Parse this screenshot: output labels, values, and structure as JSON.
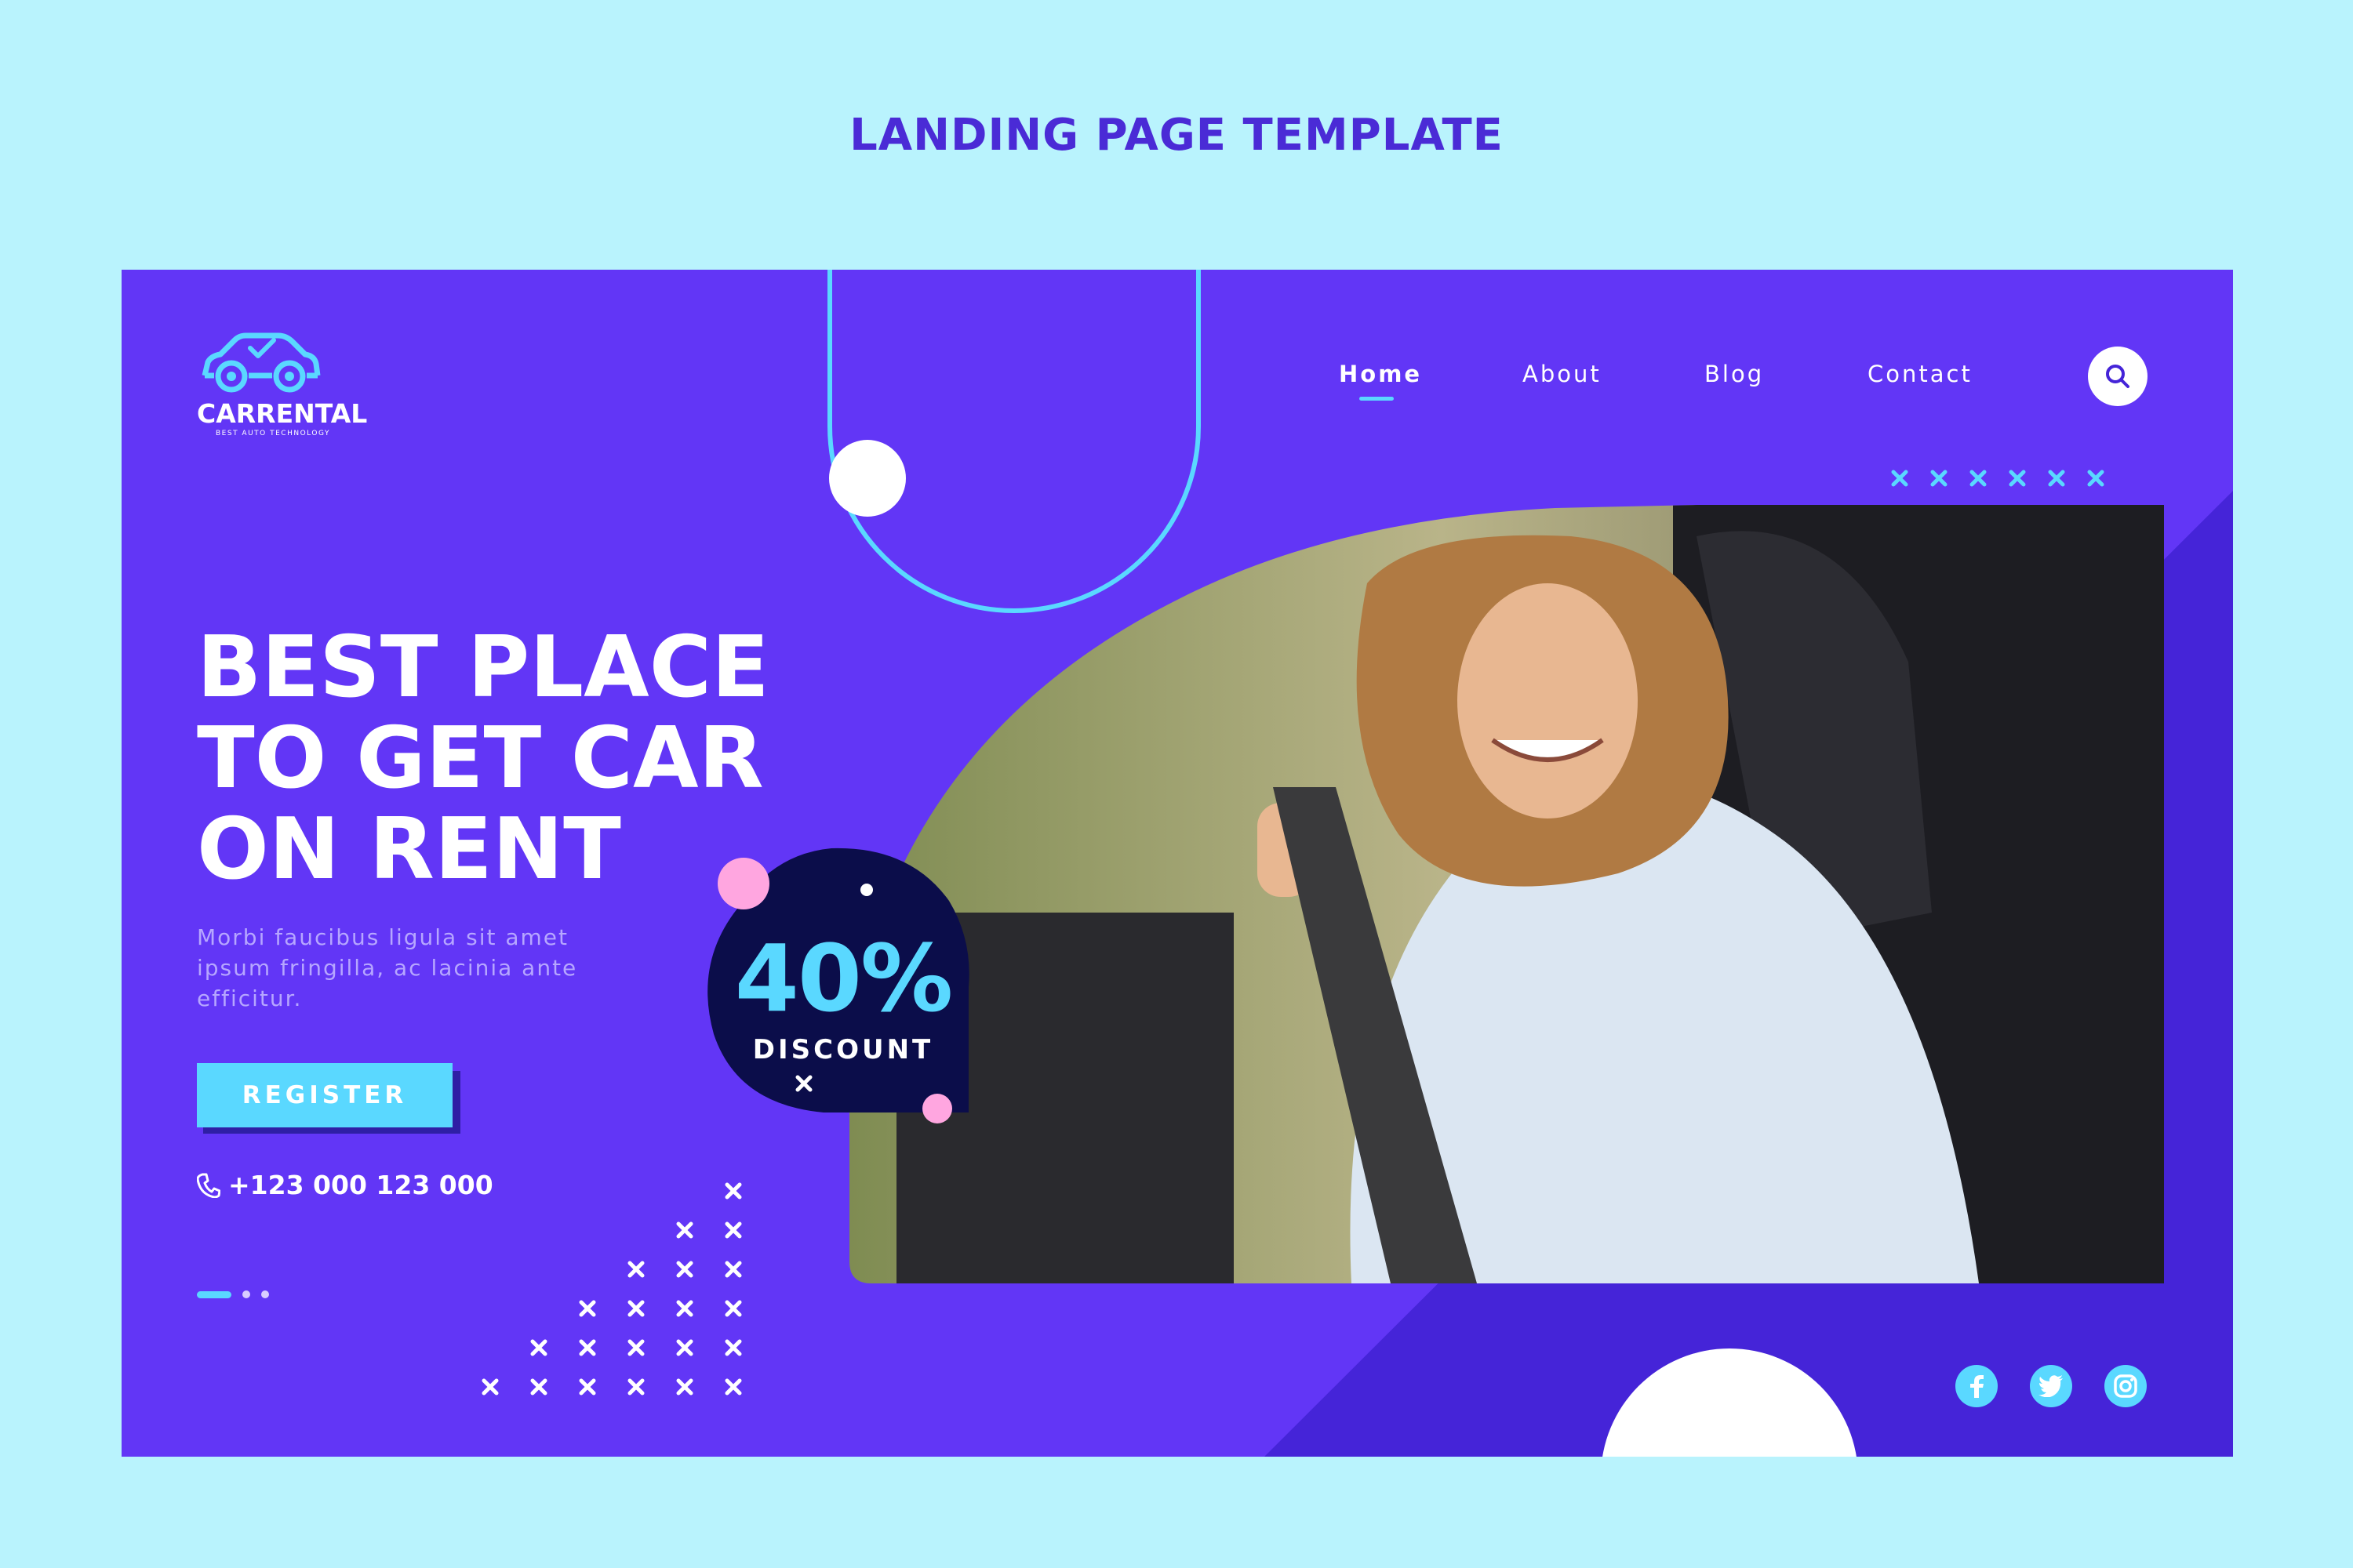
{
  "page_heading": "LANDING PAGE TEMPLATE",
  "colors": {
    "background": "#b9f3fd",
    "frame": "#6236f6",
    "frame_dark": "#4524d8",
    "accent": "#5ad8ff",
    "navy": "#0b0d4a",
    "pink": "#ffa6e0",
    "heading": "#4a2bd6"
  },
  "logo": {
    "name": "CARRENTAL",
    "tagline": "BEST AUTO TECHNOLOGY",
    "icon": "car-check-icon"
  },
  "nav": {
    "items": [
      {
        "label": "Home",
        "active": true
      },
      {
        "label": "About",
        "active": false
      },
      {
        "label": "Blog",
        "active": false
      },
      {
        "label": "Contact",
        "active": false
      }
    ],
    "search_icon": "search-icon"
  },
  "hero": {
    "headline_lines": [
      "BEST PLACE",
      "TO GET CAR",
      "ON RENT"
    ],
    "subtext": "Morbi faucibus ligula sit amet ipsum fringilla, ac lacinia ante efficitur.",
    "register_label": "REGISTER",
    "phone": "+123 000 123 000",
    "phone_icon": "phone-icon"
  },
  "badge": {
    "percent": "40%",
    "label": "DISCOUNT"
  },
  "photo": {
    "icon": "woman-fastening-seatbelt-photo"
  },
  "slider": {
    "total": 3,
    "active": 1
  },
  "socials": [
    {
      "name": "facebook-icon"
    },
    {
      "name": "twitter-icon"
    },
    {
      "name": "instagram-icon"
    }
  ]
}
